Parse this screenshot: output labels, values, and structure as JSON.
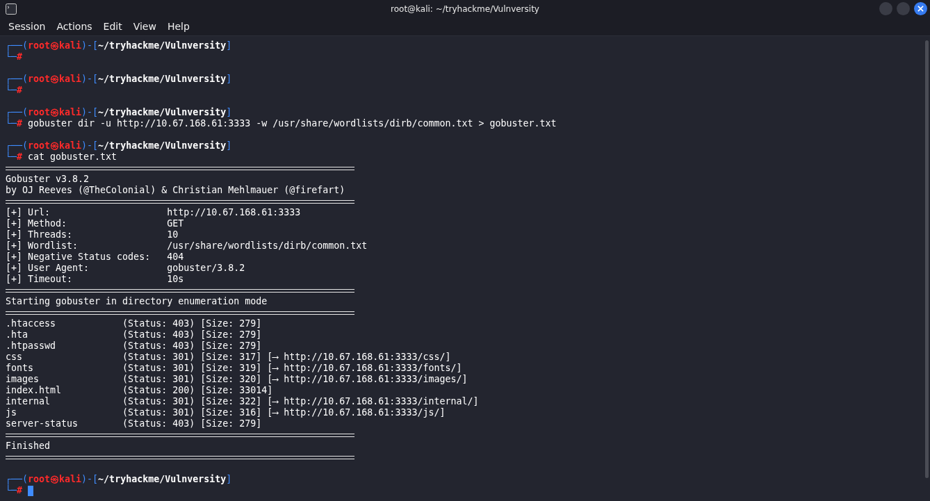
{
  "window": {
    "title": "root@kali: ~/tryhackme/Vulnversity"
  },
  "menu": [
    "Session",
    "Actions",
    "Edit",
    "View",
    "Help"
  ],
  "lines": [
    {
      "kind": "prompt",
      "open": "┌──(",
      "user": "root㉿kali",
      "mid": ")-[",
      "path": "~/tryhackme/Vulnversity",
      "close": "]",
      "corner": "└─",
      "symbol": "#",
      "cursor": false
    },
    {
      "kind": "blank"
    },
    {
      "kind": "prompt",
      "open": "┌──(",
      "user": "root㉿kali",
      "mid": ")-[",
      "path": "~/tryhackme/Vulnversity",
      "close": "]",
      "corner": "└─",
      "symbol": "#",
      "cursor": false
    },
    {
      "kind": "blank"
    },
    {
      "kind": "prompt",
      "open": "┌──(",
      "user": "root㉿kali",
      "mid": ")-[",
      "path": "~/tryhackme/Vulnversity",
      "close": "]",
      "corner": "└─",
      "symbol": "#",
      "command": "gobuster dir -u http://10.67.168.61:3333 -w /usr/share/wordlists/dirb/common.txt > gobuster.txt",
      "cursor": false
    },
    {
      "kind": "blank"
    },
    {
      "kind": "prompt",
      "open": "┌──(",
      "user": "root㉿kali",
      "mid": ")-[",
      "path": "~/tryhackme/Vulnversity",
      "close": "]",
      "corner": "└─",
      "symbol": "#",
      "command": "cat gobuster.txt",
      "cursor": false
    },
    {
      "kind": "rule"
    },
    {
      "kind": "text",
      "text": "Gobuster v3.8.2"
    },
    {
      "kind": "text",
      "text": "by OJ Reeves (@TheColonial) & Christian Mehlmauer (@firefart)"
    },
    {
      "kind": "rule"
    },
    {
      "kind": "text",
      "text": "[+] Url:                     http://10.67.168.61:3333"
    },
    {
      "kind": "text",
      "text": "[+] Method:                  GET"
    },
    {
      "kind": "text",
      "text": "[+] Threads:                 10"
    },
    {
      "kind": "text",
      "text": "[+] Wordlist:                /usr/share/wordlists/dirb/common.txt"
    },
    {
      "kind": "text",
      "text": "[+] Negative Status codes:   404"
    },
    {
      "kind": "text",
      "text": "[+] User Agent:              gobuster/3.8.2"
    },
    {
      "kind": "text",
      "text": "[+] Timeout:                 10s"
    },
    {
      "kind": "rule"
    },
    {
      "kind": "text",
      "text": "Starting gobuster in directory enumeration mode"
    },
    {
      "kind": "rule"
    },
    {
      "kind": "text",
      "text": ".htaccess            (Status: 403) [Size: 279]"
    },
    {
      "kind": "text",
      "text": ".hta                 (Status: 403) [Size: 279]"
    },
    {
      "kind": "text",
      "text": ".htpasswd            (Status: 403) [Size: 279]"
    },
    {
      "kind": "text",
      "text": "css                  (Status: 301) [Size: 317] [⟶ http://10.67.168.61:3333/css/]"
    },
    {
      "kind": "text",
      "text": "fonts                (Status: 301) [Size: 319] [⟶ http://10.67.168.61:3333/fonts/]"
    },
    {
      "kind": "text",
      "text": "images               (Status: 301) [Size: 320] [⟶ http://10.67.168.61:3333/images/]"
    },
    {
      "kind": "text",
      "text": "index.html           (Status: 200) [Size: 33014]"
    },
    {
      "kind": "text",
      "text": "internal             (Status: 301) [Size: 322] [⟶ http://10.67.168.61:3333/internal/]"
    },
    {
      "kind": "text",
      "text": "js                   (Status: 301) [Size: 316] [⟶ http://10.67.168.61:3333/js/]"
    },
    {
      "kind": "text",
      "text": "server-status        (Status: 403) [Size: 279]"
    },
    {
      "kind": "rule"
    },
    {
      "kind": "text",
      "text": "Finished"
    },
    {
      "kind": "rule"
    },
    {
      "kind": "blank"
    },
    {
      "kind": "prompt",
      "open": "┌──(",
      "user": "root㉿kali",
      "mid": ")-[",
      "path": "~/tryhackme/Vulnversity",
      "close": "]",
      "corner": "└─",
      "symbol": "#",
      "cursor": true
    }
  ]
}
